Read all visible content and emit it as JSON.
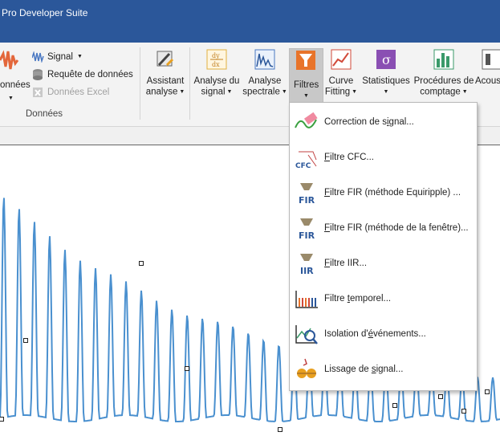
{
  "window": {
    "title": "Pro Developer Suite"
  },
  "ribbon": {
    "donnees_group": {
      "left_button_label": "onnées",
      "signal_label": "Signal",
      "requete_label": "Requête de données",
      "excel_label": "Données Excel",
      "group_label": "Données"
    },
    "buttons": [
      {
        "line1": "Assistant",
        "line2": "analyse"
      },
      {
        "line1": "Analyse du",
        "line2": "signal"
      },
      {
        "line1": "Analyse",
        "line2": "spectrale"
      },
      {
        "line1": "Filtres",
        "line2": ""
      },
      {
        "line1": "Curve",
        "line2": "Fitting"
      },
      {
        "line1": "Statistiques",
        "line2": ""
      },
      {
        "line1": "Procédures de",
        "line2": "comptage"
      },
      {
        "line1": "Acous",
        "line2": ""
      }
    ]
  },
  "menu": {
    "items": [
      {
        "before": "Correction de s",
        "underline": "i",
        "after": "gnal...",
        "icon": "correction-icon"
      },
      {
        "before": "",
        "underline": "F",
        "after": "iltre CFC...",
        "icon": "cfc-icon"
      },
      {
        "before": "",
        "underline": "F",
        "after": "iltre FIR (méthode Equiripple) ...",
        "icon": "fir-icon"
      },
      {
        "before": "",
        "underline": "F",
        "after": "iltre FIR (méthode de la fenêtre)...",
        "icon": "fir-window-icon"
      },
      {
        "before": "",
        "underline": "F",
        "after": "iltre IIR...",
        "icon": "iir-icon"
      },
      {
        "before": "Filtre ",
        "underline": "t",
        "after": "emporel...",
        "icon": "temporal-icon"
      },
      {
        "before": "Isolation d'",
        "underline": "é",
        "after": "vénements...",
        "icon": "isolation-icon"
      },
      {
        "before": "Lissage de ",
        "underline": "s",
        "after": "ignal...",
        "icon": "smoothing-icon"
      }
    ]
  },
  "colors": {
    "titlebar": "#2b579a",
    "signal_line": "#4a90cf",
    "ribbon_bg": "#f3f3f3"
  }
}
